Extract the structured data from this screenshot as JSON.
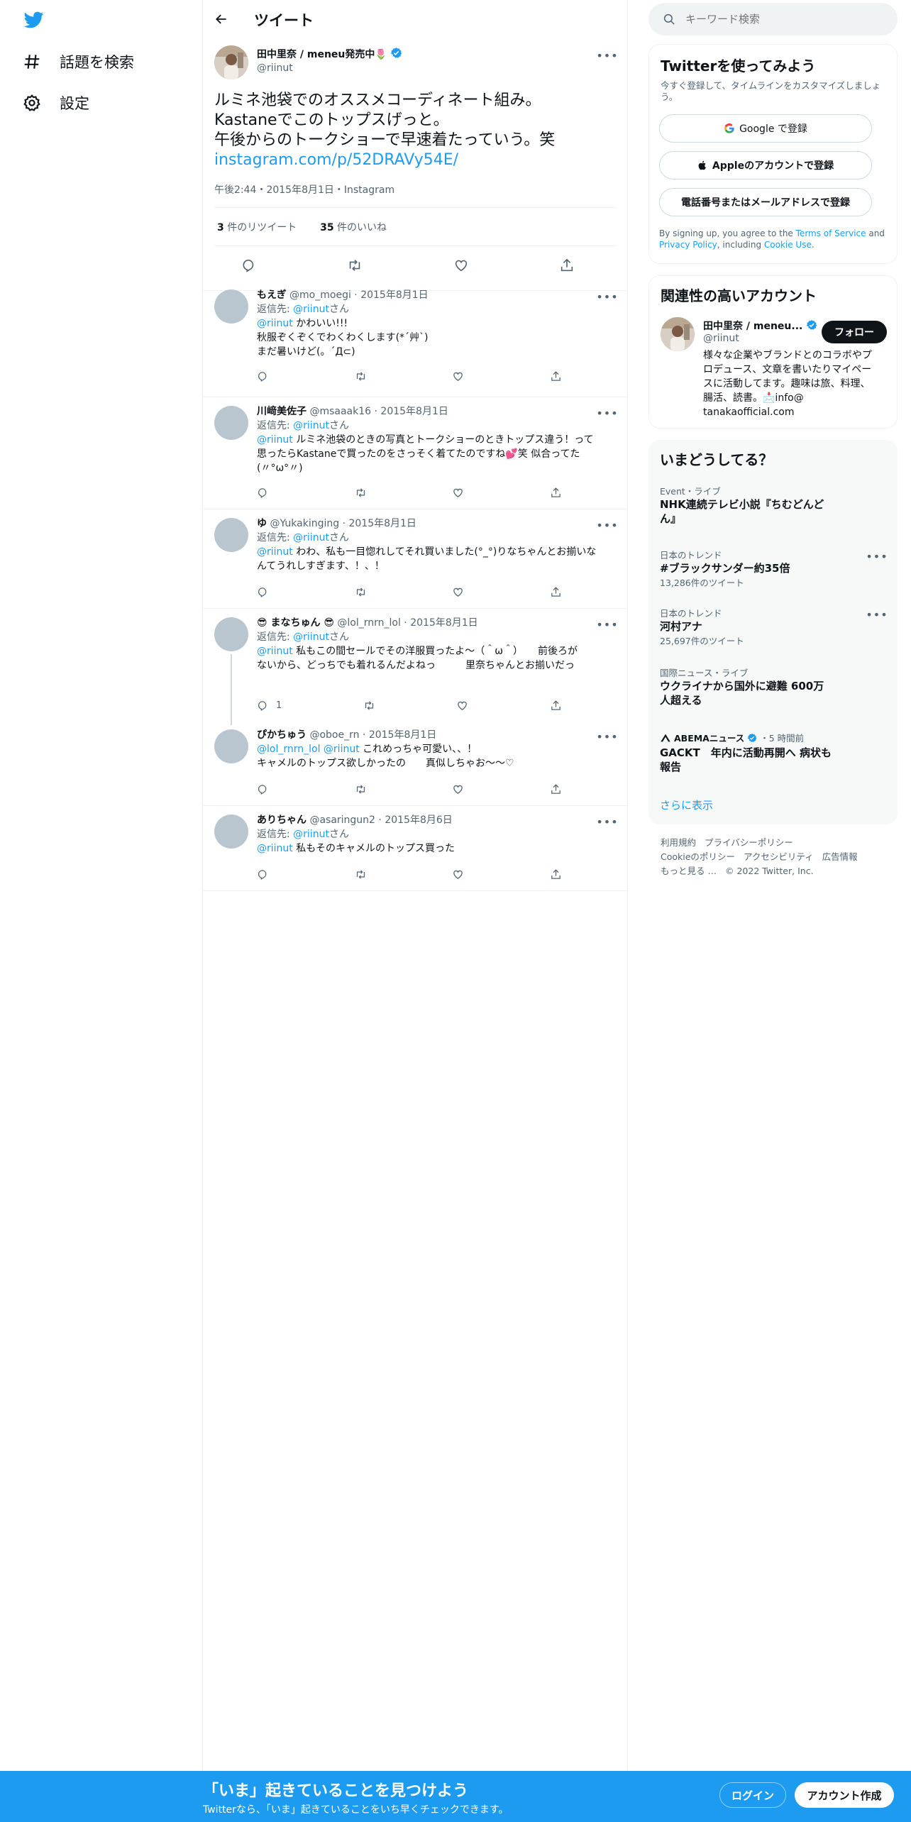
{
  "nav": {
    "explore_label": "話題を検索",
    "settings_label": "設定"
  },
  "header": {
    "title": "ツイート"
  },
  "tweet": {
    "author_name": "田中里奈 / meneu発売中🌷",
    "author_handle": "@riinut",
    "text_line1": "ルミネ池袋でのオススメコーディネート組み。",
    "text_line2": "Kastaneでこのトップスげっと。",
    "text_line3": "午後からのトークショーで早速着たっていう。笑",
    "link": "instagram.com/p/52DRAVy54E/",
    "timestamp": "午後2:44・2015年8月1日・Instagram",
    "retweets_count": "3",
    "retweets_label": " 件のリツイート",
    "likes_count": "35",
    "likes_label": " 件のいいね"
  },
  "replies": [
    {
      "name": "もえぎ",
      "handle": "@mo_moegi",
      "date": "2015年8月1日",
      "reply_prefix": "返信先: ",
      "reply_to": "@riinut",
      "reply_suffix": "さん",
      "mention": "@riinut",
      "text": " かわいい!!!",
      "text2": "秋服ぞくぞくでわくわくします(*´艸`)",
      "text3": "まだ暑いけど(。´Д⊂)"
    },
    {
      "name": "川﨑美佐子",
      "handle": "@msaaak16",
      "date": "2015年8月1日",
      "reply_prefix": "返信先: ",
      "reply_to": "@riinut",
      "reply_suffix": "さん",
      "mention": "@riinut",
      "text": " ルミネ池袋のときの写真とトークショーのときトップス違う！って",
      "text2": "思ったらKastaneで買ったのをさっそく着てたのですね💕笑 似合ってた",
      "text3": "(〃°ω°〃)"
    },
    {
      "name": "ゆ",
      "handle": "@Yukakinging",
      "date": "2015年8月1日",
      "reply_prefix": "返信先: ",
      "reply_to": "@riinut",
      "reply_suffix": "さん",
      "mention": "@riinut",
      "text": " わわ、私も一目惚れしてそれ買いました(°_°)りなちゃんとお揃いな",
      "text2": "んてうれしすぎます、！、！"
    },
    {
      "name": "😎 まなちゅん 😎",
      "handle": "@lol_rnrn_lol",
      "date": "2015年8月1日",
      "reply_prefix": "返信先: ",
      "reply_to": "@riinut",
      "reply_suffix": "さん",
      "mention": "@riinut",
      "text": " 私もこの間セールでその洋服買ったよ〜（＾ω＾）　　前後ろが",
      "text2": "ないから、どっちでも着れるんだよねっ　　　里奈ちゃんとお揃いだっ",
      "reply_count": "1"
    },
    {
      "name": "ぴかちゅう",
      "handle": "@oboe_rn",
      "date": "2015年8月1日",
      "mention": "@lol_rnrn_lol",
      "mention2": "@riinut",
      "text": " これめっちゃ可愛い、、！",
      "text2": "キャメルのトップス欲しかったの　　真似しちゃお〜〜♡"
    },
    {
      "name": "ありちゃん",
      "handle": "@asaringun2",
      "date": "2015年8月6日",
      "reply_prefix": "返信先: ",
      "reply_to": "@riinut",
      "reply_suffix": "さん",
      "mention": "@riinut",
      "text": " 私もそのキャメルのトップス買った"
    }
  ],
  "search": {
    "placeholder": "キーワード検索"
  },
  "signup_card": {
    "title": "Twitterを使ってみよう",
    "subtitle": "今すぐ登録して、タイムラインをカスタマイズしましょう。",
    "google_label": "Google で登録",
    "apple_label": "Appleのアカウントで登録",
    "phone_label": "電話番号またはメールアドレスで登録",
    "legal_prefix": "By signing up, you agree to the ",
    "tos": "Terms of Service",
    "and": " and ",
    "privacy": "Privacy Policy",
    "including": ", including ",
    "cookie": "Cookie Use",
    "period": "."
  },
  "related": {
    "title": "関連性の高いアカウント",
    "name": "田中里奈 / meneu...",
    "handle": "@riinut",
    "follow_label": "フォロー",
    "bio1": "様々な企業やブランドとのコラボやプ",
    "bio2": "ロデュース、文章を書いたりマイペー",
    "bio3": "スに活動してます。趣味は旅、料理、",
    "bio4": "腸活、読書。📩info@",
    "bio5": "tanakaofficial.com"
  },
  "trends": {
    "title": "いまどうしてる？",
    "items": [
      {
        "context": "Event・ライブ",
        "title": "NHK連続テレビ小説『ちむどんどん』",
        "sub": ""
      },
      {
        "context": "日本のトレンド",
        "title": "#ブラックサンダー約35倍",
        "sub": "13,286件のツイート"
      },
      {
        "context": "日本のトレンド",
        "title": "河村アナ",
        "sub": "25,697件のツイート"
      },
      {
        "context": "国際ニュース・ライブ",
        "title": "ウクライナから国外に避難 600万人超える",
        "sub": ""
      },
      {
        "context": "ABEMAニュース",
        "time": "・5 時間前",
        "title": "GACKT　年内に活動再開へ 病状も報告",
        "sub": ""
      }
    ],
    "show_more": "さらに表示"
  },
  "footer": {
    "terms": "利用規約",
    "privacy": "プライバシーポリシー",
    "cookie": "Cookieのポリシー",
    "a11y": "アクセシビリティ",
    "ads": "広告情報",
    "more": "もっと見る …",
    "copyright": "© 2022 Twitter, Inc."
  },
  "bottom_bar": {
    "title": "「いま」起きていることを見つけよう",
    "subtitle": "Twitterなら、「いま」起きていることをいち早くチェックできます。",
    "login_label": "ログイン",
    "signup_label": "アカウント作成"
  },
  "colors": {
    "brand": "#1d9bf0",
    "text": "#0f1419",
    "secondary": "#536471",
    "follow_button": "#0f1419"
  }
}
